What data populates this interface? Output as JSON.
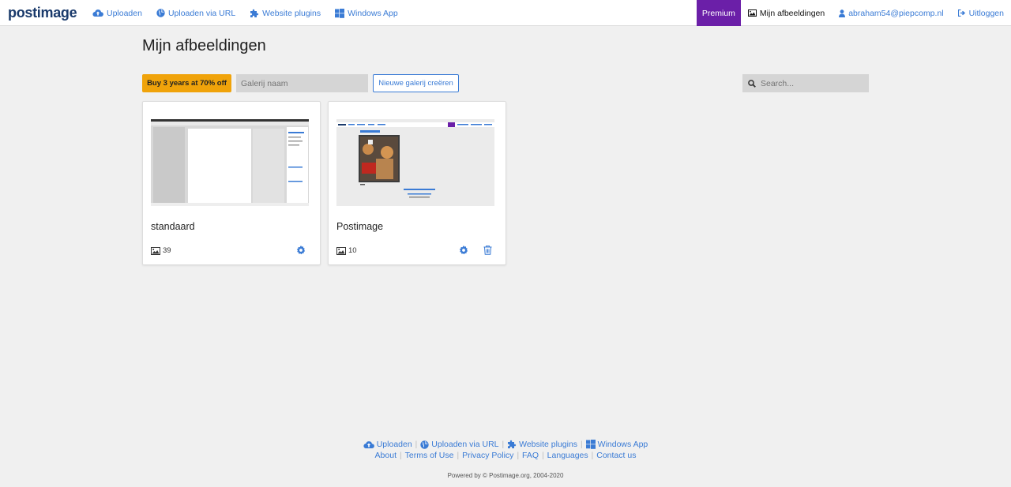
{
  "brand": {
    "logo_text": "postimage"
  },
  "nav": {
    "left": [
      {
        "label": "Uploaden",
        "icon": "cloud-upload-icon"
      },
      {
        "label": "Uploaden via URL",
        "icon": "globe-icon"
      },
      {
        "label": "Website plugins",
        "icon": "puzzle-icon"
      },
      {
        "label": "Windows App",
        "icon": "windows-icon"
      }
    ],
    "premium": "Premium",
    "my_images": "Mijn afbeeldingen",
    "user_email": "abraham54@piepcomp.nl",
    "logout": "Uitloggen"
  },
  "page": {
    "title": "Mijn afbeeldingen"
  },
  "toolbar": {
    "promo_label": "Buy 3 years at 70% off",
    "gallery_name_placeholder": "Galerij naam",
    "new_gallery_label": "Nieuwe galerij creëren",
    "search_placeholder": "Search..."
  },
  "galleries": [
    {
      "name": "standaard",
      "count": "39",
      "has_delete": false
    },
    {
      "name": "Postimage",
      "count": "10",
      "has_delete": true
    }
  ],
  "footer": {
    "links_row1": [
      "Uploaden",
      "Uploaden via URL",
      "Website plugins",
      "Windows App"
    ],
    "links_row2": [
      "About",
      "Terms of Use",
      "Privacy Policy",
      "FAQ",
      "Languages",
      "Contact us"
    ],
    "powered_by": "Powered by © Postimage.org, 2004-2020"
  },
  "colors": {
    "accent": "#3a7bd5",
    "premium": "#6b1fa8",
    "promo": "#f0a30a",
    "background": "#f0f0f0"
  }
}
